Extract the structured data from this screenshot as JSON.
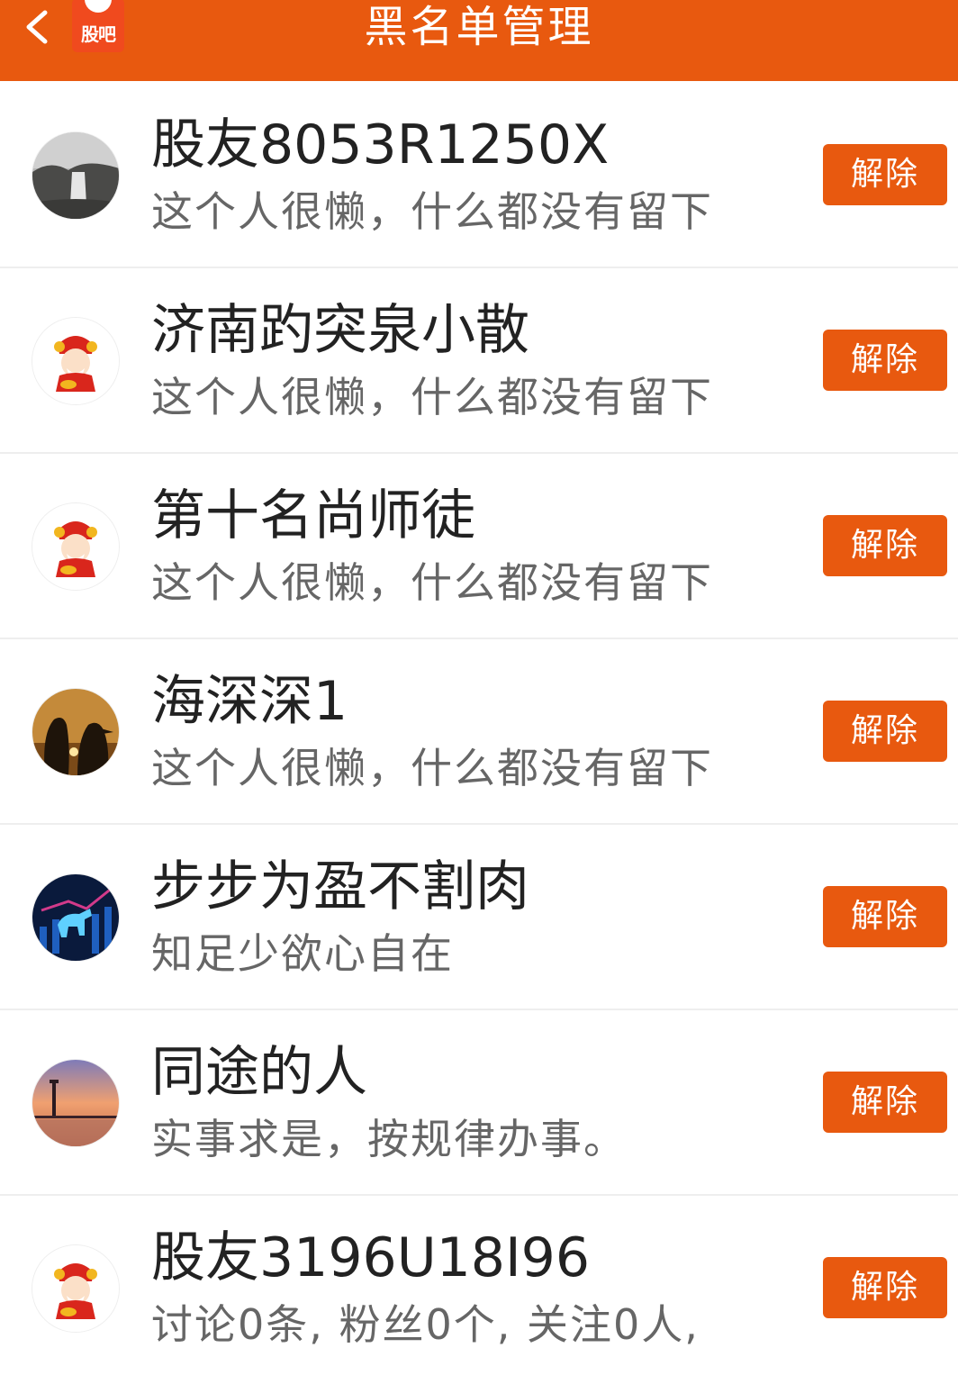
{
  "header": {
    "title": "黑名单管理",
    "logo_text": "股吧",
    "back_icon": "chevron-left-icon",
    "accent_color": "#e8590f"
  },
  "blacklist": [
    {
      "name": "股友8053R1250X",
      "bio": "这个人很懒，什么都没有留下",
      "remove_label": "解除",
      "avatar": "waterfall-landscape"
    },
    {
      "name": "济南趵突泉小散",
      "bio": "这个人很懒，什么都没有留下",
      "remove_label": "解除",
      "avatar": "fortune-god"
    },
    {
      "name": "第十名尚师徒",
      "bio": "这个人很懒，什么都没有留下",
      "remove_label": "解除",
      "avatar": "fortune-god"
    },
    {
      "name": "海深深1",
      "bio": "这个人很懒，什么都没有留下",
      "remove_label": "解除",
      "avatar": "penguins-sunset"
    },
    {
      "name": "步步为盈不割肉",
      "bio": "知足少欲心自在",
      "remove_label": "解除",
      "avatar": "blue-bull"
    },
    {
      "name": "同途的人",
      "bio": "实事求是，按规律办事。",
      "remove_label": "解除",
      "avatar": "lighthouse-sunset"
    },
    {
      "name": "股友3196U18I96",
      "bio": "讨论0条, 粉丝0个, 关注0人,",
      "remove_label": "解除",
      "avatar": "fortune-god"
    }
  ]
}
